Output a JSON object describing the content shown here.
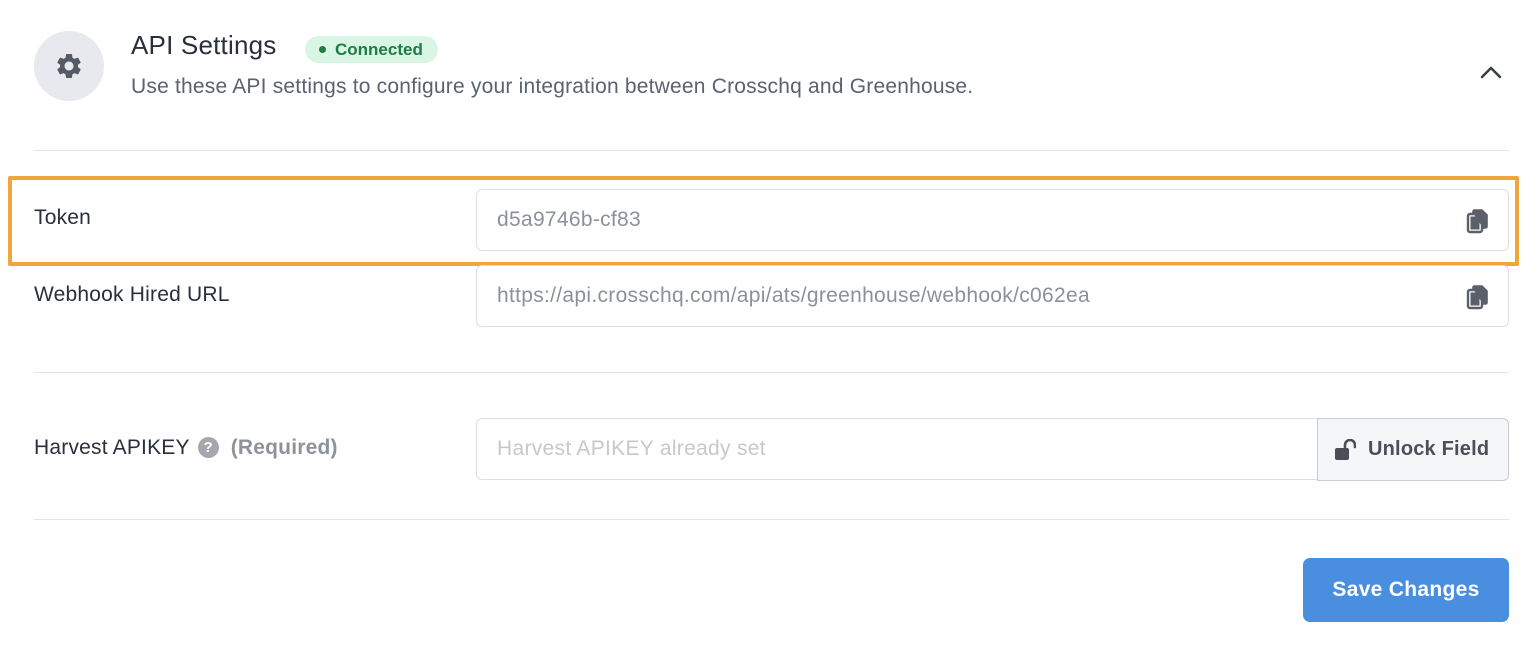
{
  "header": {
    "title": "API Settings",
    "status_badge": "Connected",
    "subtitle": "Use these API settings to configure your integration between Crosschq and Greenhouse.",
    "icon": "gear-icon",
    "collapse_icon": "chevron-up-icon"
  },
  "fields": {
    "token": {
      "label": "Token",
      "value": "d5a9746b-cf83",
      "copy_icon": "copy-icon"
    },
    "webhook": {
      "label": "Webhook Hired URL",
      "value": "https://api.crosschq.com/api/ats/greenhouse/webhook/c062ea",
      "copy_icon": "copy-icon"
    },
    "harvest": {
      "label": "Harvest APIKEY",
      "help_icon": "?",
      "required_text": "(Required)",
      "placeholder": "Harvest APIKEY already set",
      "unlock_label": "Unlock Field",
      "unlock_icon": "unlock-icon"
    }
  },
  "actions": {
    "save_label": "Save Changes"
  },
  "colors": {
    "accent": "#4a8ee0",
    "badge_bg": "#d9f5e3",
    "badge_text": "#1e7d45",
    "highlight": "#f0a63a"
  }
}
